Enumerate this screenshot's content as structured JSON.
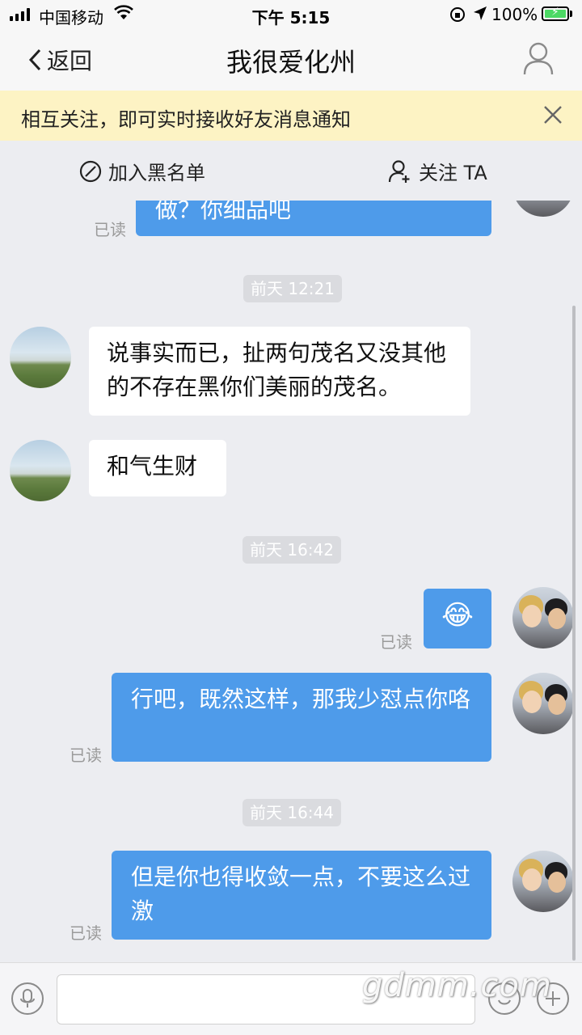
{
  "status_bar": {
    "carrier": "中国移动",
    "time": "下午 5:15",
    "battery": "100%"
  },
  "nav": {
    "back_label": "返回",
    "title": "我很爱化州"
  },
  "banner": {
    "text": "相互关注，即可实时接收好友消息通知"
  },
  "actions": {
    "block_label": "加入黑名单",
    "follow_label": "关注 TA"
  },
  "messages": [
    {
      "side": "out",
      "text": "做？你细品吧",
      "read": "已读"
    },
    {
      "type": "timestamp",
      "text": "前天 12:21"
    },
    {
      "side": "in",
      "text": "说事实而已，扯两句茂名又没其他的不存在黑你们美丽的茂名。"
    },
    {
      "side": "in",
      "text": "和气生财"
    },
    {
      "type": "timestamp",
      "text": "前天 16:42"
    },
    {
      "side": "out",
      "text": "😂",
      "read": "已读"
    },
    {
      "side": "out",
      "text": "行吧，既然这样，那我少怼点你咯",
      "read": "已读"
    },
    {
      "type": "timestamp",
      "text": "前天 16:44"
    },
    {
      "side": "out",
      "text": "但是你也得收敛一点，不要这么过激",
      "read": "已读"
    }
  ],
  "input": {
    "placeholder": ""
  },
  "watermark": "gdmm.com",
  "colors": {
    "outgoing_bubble": "#4e9bea",
    "incoming_bubble": "#ffffff",
    "banner_bg": "#fdf3c4",
    "background": "#ecedf1"
  }
}
